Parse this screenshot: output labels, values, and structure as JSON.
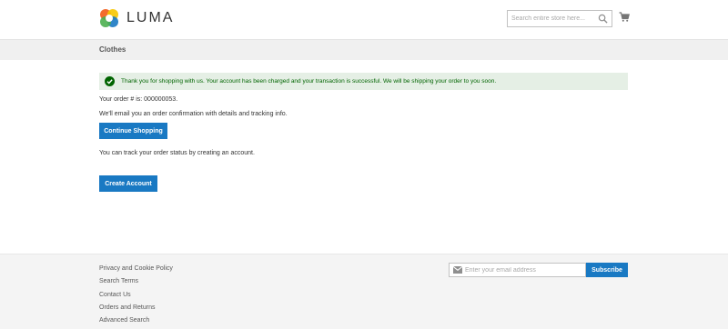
{
  "header": {
    "brand": "LUMA",
    "search": {
      "placeholder": "Search entire store here...",
      "value": ""
    },
    "cart_icon": "cart-icon",
    "search_icon": "search-icon"
  },
  "nav": {
    "items": [
      {
        "label": "Clothes"
      }
    ]
  },
  "main": {
    "success_message": "Thank you for shopping with us. Your account has been charged and your transaction is successful. We will be shipping your order to you soon.",
    "order_line": "Your order # is: 000000053.",
    "email_line": "We'll email you an order confirmation with details and tracking info.",
    "continue_label": "Continue Shopping",
    "track_line": "You can track your order status by creating an account.",
    "create_label": "Create Account"
  },
  "footer": {
    "links": [
      {
        "label": "Privacy and Cookie Policy"
      },
      {
        "label": "Search Terms"
      },
      {
        "label": "Contact Us"
      },
      {
        "label": "Orders and Returns"
      },
      {
        "label": "Advanced Search"
      }
    ],
    "newsletter": {
      "placeholder": "Enter your email address",
      "value": "",
      "subscribe_label": "Subscribe"
    }
  },
  "colors": {
    "accent": "#1979c3",
    "success_bg": "#e5efe5",
    "success_text": "#006400",
    "nav_bg": "#f0f0f0",
    "footer_bg": "#f4f4f4"
  }
}
